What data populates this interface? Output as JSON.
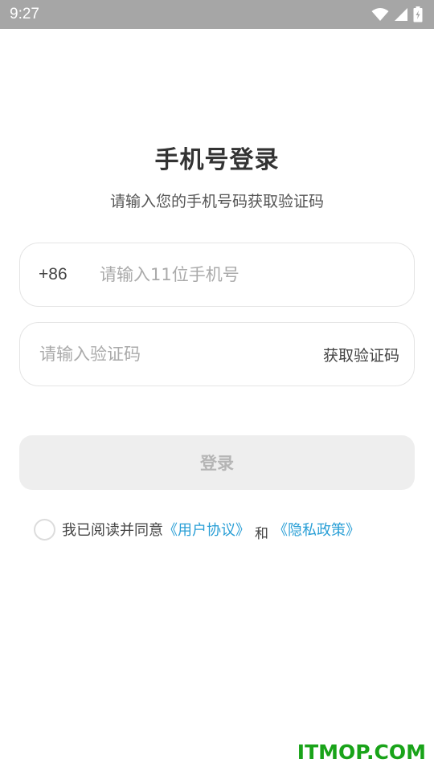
{
  "status_bar": {
    "time": "9:27",
    "icons": [
      "wifi-icon",
      "signal-icon",
      "battery-charging-icon"
    ]
  },
  "page": {
    "title": "手机号登录",
    "subtitle": "请输入您的手机号码获取验证码"
  },
  "phone_field": {
    "country_code": "+86",
    "placeholder": "请输入11位手机号",
    "value": ""
  },
  "code_field": {
    "placeholder": "请输入验证码",
    "value": "",
    "get_code_label": "获取验证码"
  },
  "login_button": {
    "label": "登录"
  },
  "agreement": {
    "checked": false,
    "prefix": "我已阅读并同意",
    "user_agreement": "《用户协议》",
    "and": "和",
    "privacy_policy": "《隐私政策》"
  },
  "colors": {
    "status_bar": "#a6a6a6",
    "link": "#2a9fd6",
    "login_disabled_bg": "#eeeeee",
    "watermark": "#19a319"
  },
  "watermark": {
    "text": "ITMOP.COM"
  }
}
